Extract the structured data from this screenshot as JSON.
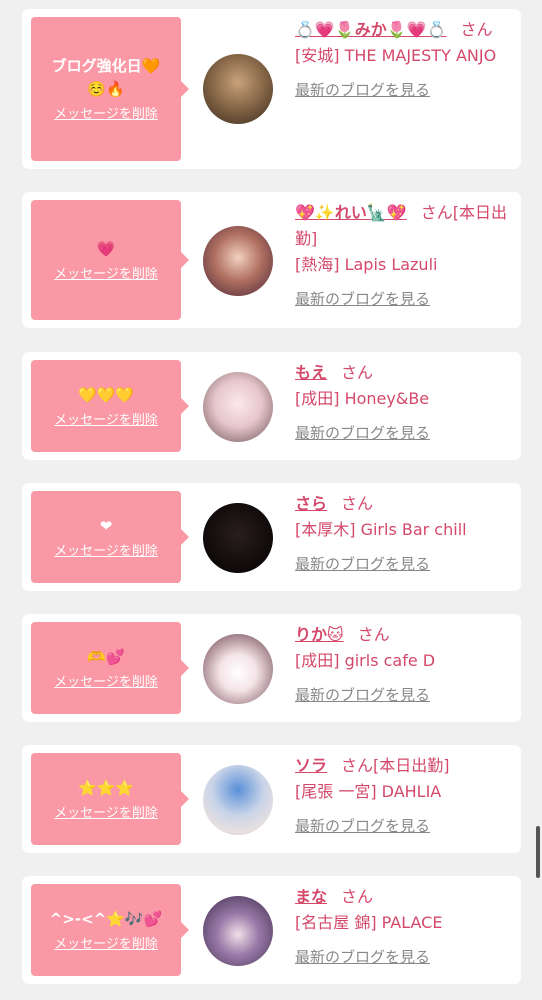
{
  "delete_label": "メッセージを削除",
  "blog_label": "最新のブログを見る",
  "honorific": "さん",
  "colors": {
    "bubble": "#fb98a5",
    "accent": "#d4486a",
    "link_gray": "#888888",
    "background": "#f0f0f0"
  },
  "cards": [
    {
      "message": "ブログ強化日🧡\n☺️🔥",
      "name": "💍💗🌷みか🌷💗💍",
      "suffix": "",
      "shop": "[安城] THE MAJESTY ANJO"
    },
    {
      "message": "💗",
      "name": "💖✨れい🗽💖",
      "suffix": "[本日出勤]",
      "shop": "[熱海] Lapis Lazuli"
    },
    {
      "message": "💛💛💛",
      "name": "もえ",
      "suffix": "",
      "shop": "[成田] Honey&Be"
    },
    {
      "message": "❤",
      "name": "さら",
      "suffix": "",
      "shop": "[本厚木] Girls Bar chill"
    },
    {
      "message": "🫶💕",
      "name": "りか🐱",
      "suffix": "",
      "shop": "[成田] girls cafe D"
    },
    {
      "message": "⭐⭐⭐",
      "name": "ソラ",
      "suffix": "[本日出勤]",
      "shop": "[尾張 一宮] DAHLIA"
    },
    {
      "message": "^>-<^⭐🎶💕",
      "name": "まな",
      "suffix": "",
      "shop": "[名古屋 錦] PALACE"
    }
  ]
}
